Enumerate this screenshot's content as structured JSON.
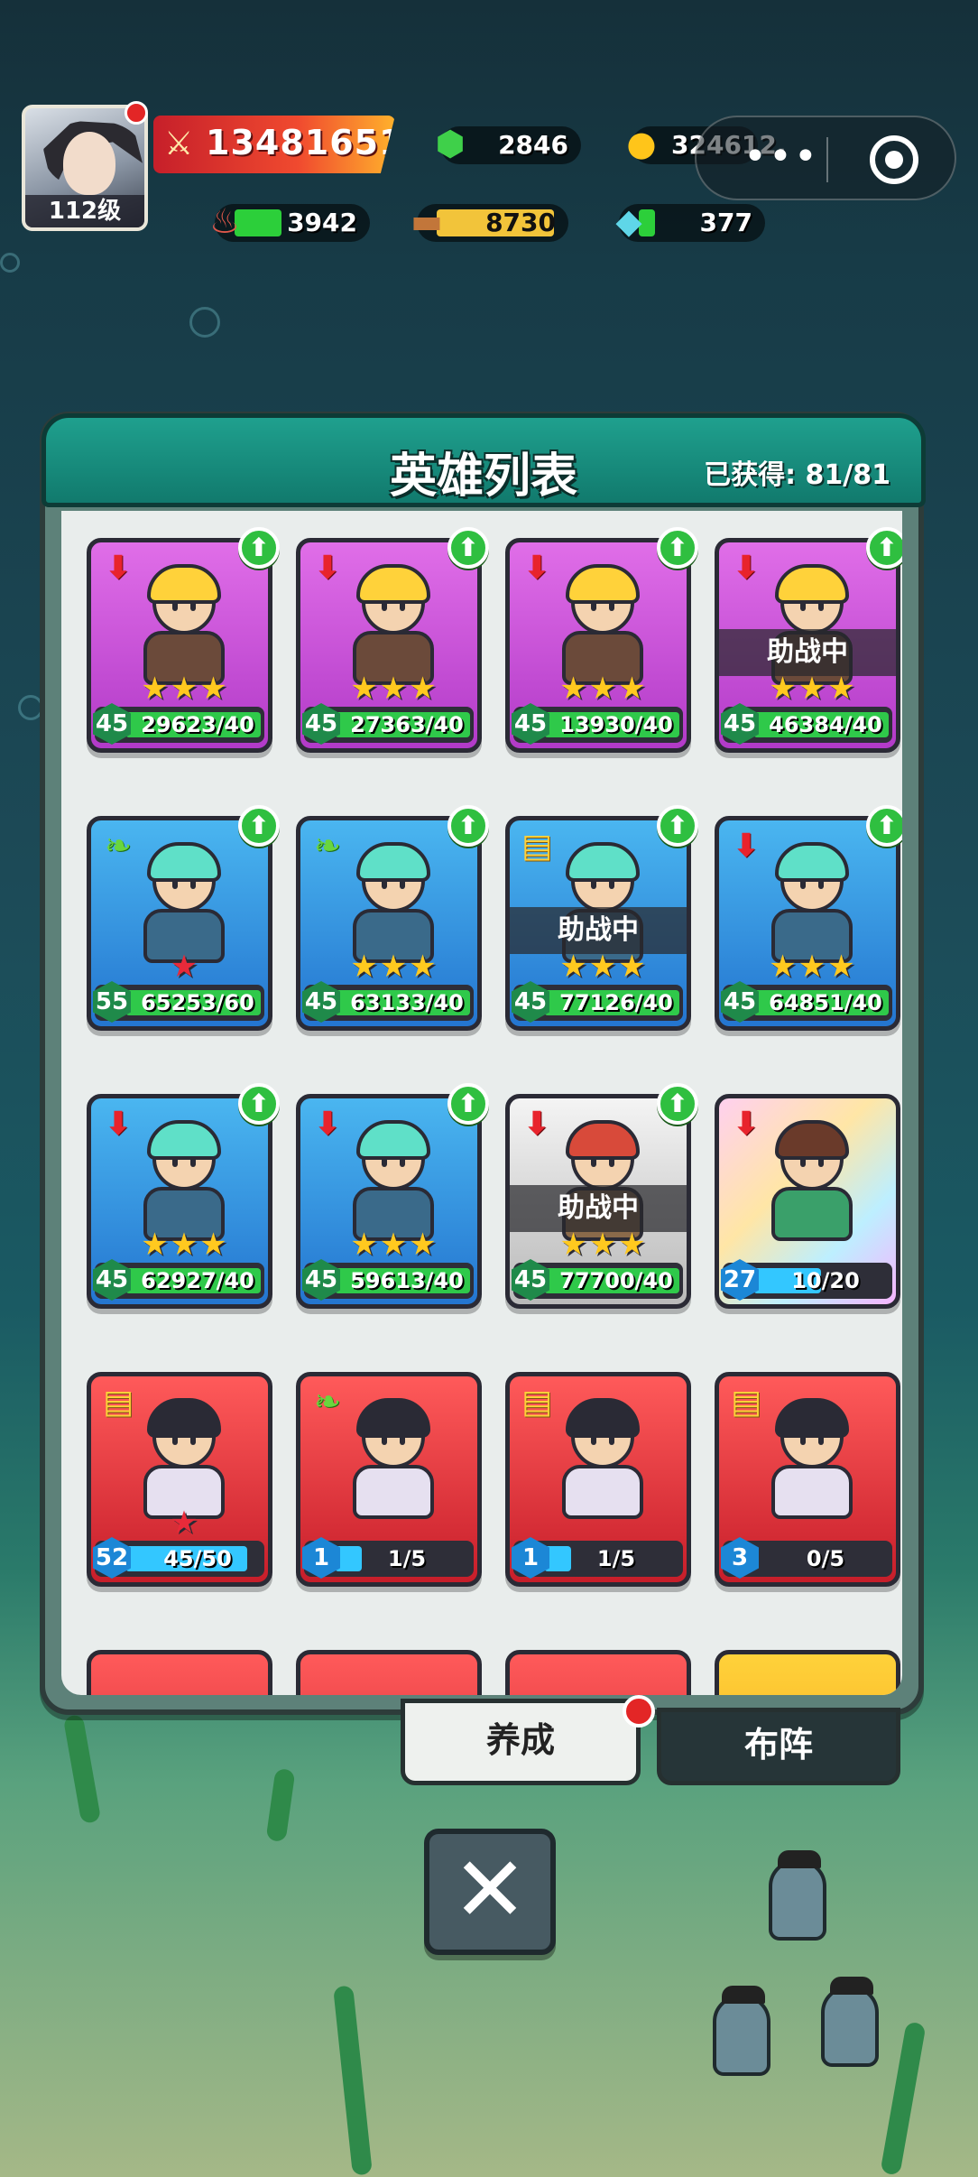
{
  "player": {
    "level": "112级"
  },
  "hud": {
    "power": "13481651",
    "gems": "2846",
    "coins": "324612.",
    "meat": "3942",
    "wood": "8730",
    "crystal": "377"
  },
  "panel": {
    "title": "英雄列表",
    "obtained": "已获得: 81/81"
  },
  "assist_label": "助战中",
  "heroes": [
    {
      "rarity": "purple",
      "type": "red-up",
      "level": "45",
      "progress": "29623/40",
      "stars": "★★★",
      "upgrade": true,
      "assist": false
    },
    {
      "rarity": "purple",
      "type": "red-up",
      "level": "45",
      "progress": "27363/40",
      "stars": "★★★",
      "upgrade": true,
      "assist": false
    },
    {
      "rarity": "purple",
      "type": "red-up",
      "level": "45",
      "progress": "13930/40",
      "stars": "★★★",
      "upgrade": true,
      "assist": false
    },
    {
      "rarity": "purple",
      "type": "red-up",
      "level": "45",
      "progress": "46384/40",
      "stars": "★★★",
      "upgrade": true,
      "assist": true
    },
    {
      "rarity": "blue",
      "type": "leaf",
      "level": "55",
      "progress": "65253/60",
      "stars": "★",
      "upgrade": true,
      "assist": false
    },
    {
      "rarity": "blue",
      "type": "leaf",
      "level": "45",
      "progress": "63133/40",
      "stars": "★★★",
      "upgrade": true,
      "assist": false
    },
    {
      "rarity": "blue",
      "type": "book",
      "level": "45",
      "progress": "77126/40",
      "stars": "★★★",
      "upgrade": true,
      "assist": true
    },
    {
      "rarity": "blue",
      "type": "red-up",
      "level": "45",
      "progress": "64851/40",
      "stars": "★★★",
      "upgrade": true,
      "assist": false
    },
    {
      "rarity": "blue",
      "type": "red-up",
      "level": "45",
      "progress": "62927/40",
      "stars": "★★★",
      "upgrade": true,
      "assist": false
    },
    {
      "rarity": "blue",
      "type": "red-up",
      "level": "45",
      "progress": "59613/40",
      "stars": "★★★",
      "upgrade": true,
      "assist": false
    },
    {
      "rarity": "gray",
      "type": "red-up",
      "level": "45",
      "progress": "77700/40",
      "stars": "★★★",
      "upgrade": true,
      "assist": true
    },
    {
      "rarity": "rainbow",
      "type": "red-up",
      "level": "27",
      "progress": "10/20",
      "stars": "",
      "upgrade": false,
      "assist": false
    },
    {
      "rarity": "red",
      "type": "book",
      "level": "52",
      "progress": "45/50",
      "stars": "★",
      "upgrade": false,
      "assist": false
    },
    {
      "rarity": "red",
      "type": "leaf",
      "level": "1",
      "progress": "1/5",
      "stars": "",
      "upgrade": false,
      "assist": false
    },
    {
      "rarity": "red",
      "type": "book",
      "level": "1",
      "progress": "1/5",
      "stars": "",
      "upgrade": false,
      "assist": false
    },
    {
      "rarity": "red",
      "type": "book",
      "level": "3",
      "progress": "0/5",
      "stars": "",
      "upgrade": false,
      "assist": false
    }
  ],
  "tabs": {
    "train": "养成",
    "formation": "布阵"
  },
  "icons": {
    "close": "close-icon",
    "upgrade": "upgrade-arrow-icon",
    "gem": "gem-icon",
    "coin": "coin-icon",
    "meat": "meat-icon",
    "wood": "wood-icon",
    "crystal": "crystal-icon"
  },
  "colors": {
    "panel_header": "#1fa08e",
    "purple_card": "#c04ad6",
    "blue_card": "#2f8fe0",
    "red_card": "#e0323a",
    "upgrade_badge": "#2fbf40",
    "notification": "#e32626"
  }
}
